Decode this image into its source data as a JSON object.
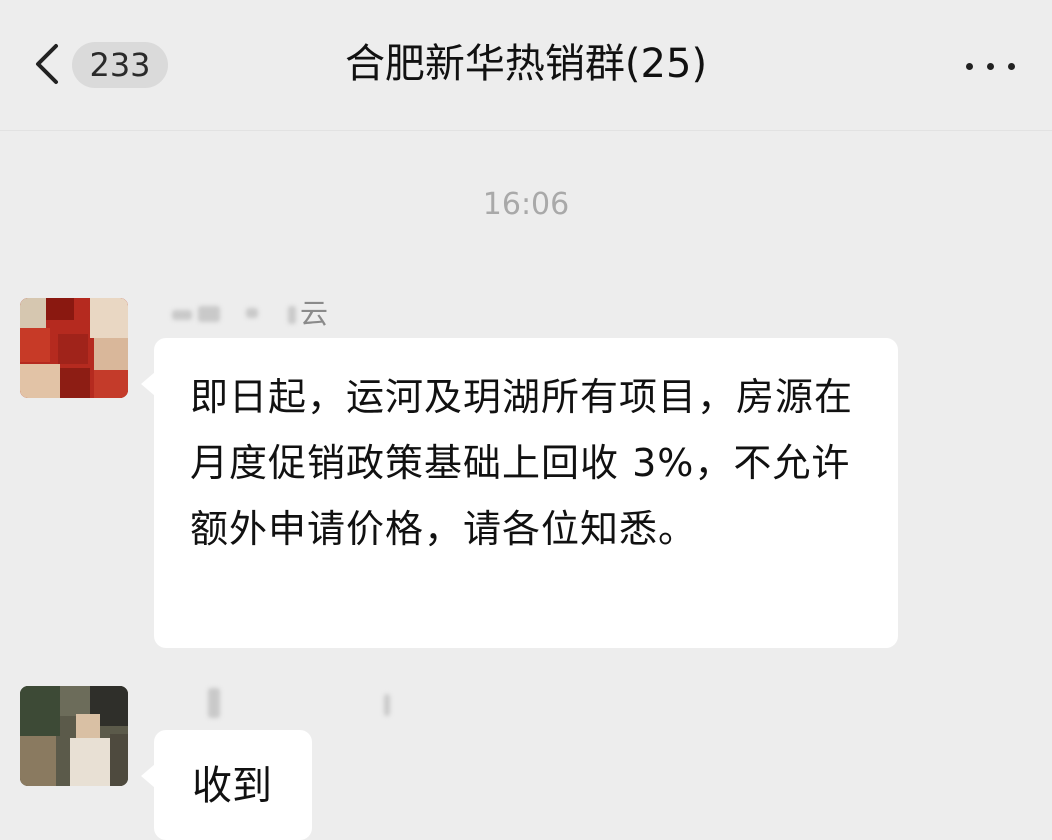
{
  "header": {
    "unread_count": "233",
    "title": "合肥新华热销群(25)"
  },
  "icons": {
    "back": "chevron-left-icon",
    "more": "more-horizontal-icon"
  },
  "chat": {
    "timestamp": "16:06",
    "messages": [
      {
        "sender_visible": "云",
        "text": "即日起，运河及玥湖所有项目，房源在月度促销政策基础上回收 3%，不允许额外申请价格，请各位知悉。"
      },
      {
        "sender_visible": "",
        "text": "收到"
      }
    ]
  },
  "colors": {
    "background": "#ededed",
    "bubble": "#ffffff",
    "badge": "#dadada",
    "timestamp": "#a9a9a9"
  }
}
